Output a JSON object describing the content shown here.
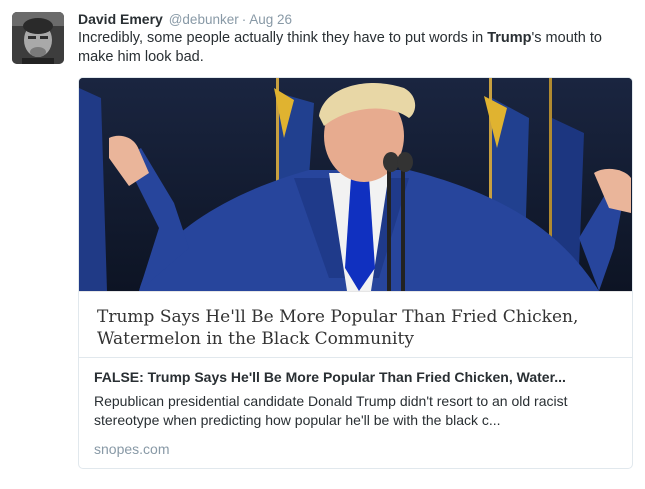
{
  "tweet": {
    "author_name": "David Emery",
    "author_handle": "@debunker",
    "separator": "·",
    "date": "Aug 26",
    "text_before": "Incredibly, some people actually think they have to put words in ",
    "text_bold": "Trump",
    "text_after": "'s mouth to make him look bad.",
    "avatar_icon": "user-avatar-photo"
  },
  "card": {
    "image_icon": "article-photo-speaker-at-podium",
    "headline_line1": "Trump Says He'll Be More Popular Than Fried Chicken,",
    "headline_line2": "Watermelon in the Black Community",
    "title": "FALSE: Trump Says He'll Be More Popular Than Fried Chicken, Water...",
    "description": "Republican presidential candidate Donald Trump didn't resort to an old racist stereotype when predicting how popular he'll be with the black c...",
    "domain": "snopes.com"
  },
  "colors": {
    "name": "#292f33",
    "secondary": "#8899a6",
    "card_border": "#e1e8ed",
    "headline_text": "#333333"
  }
}
